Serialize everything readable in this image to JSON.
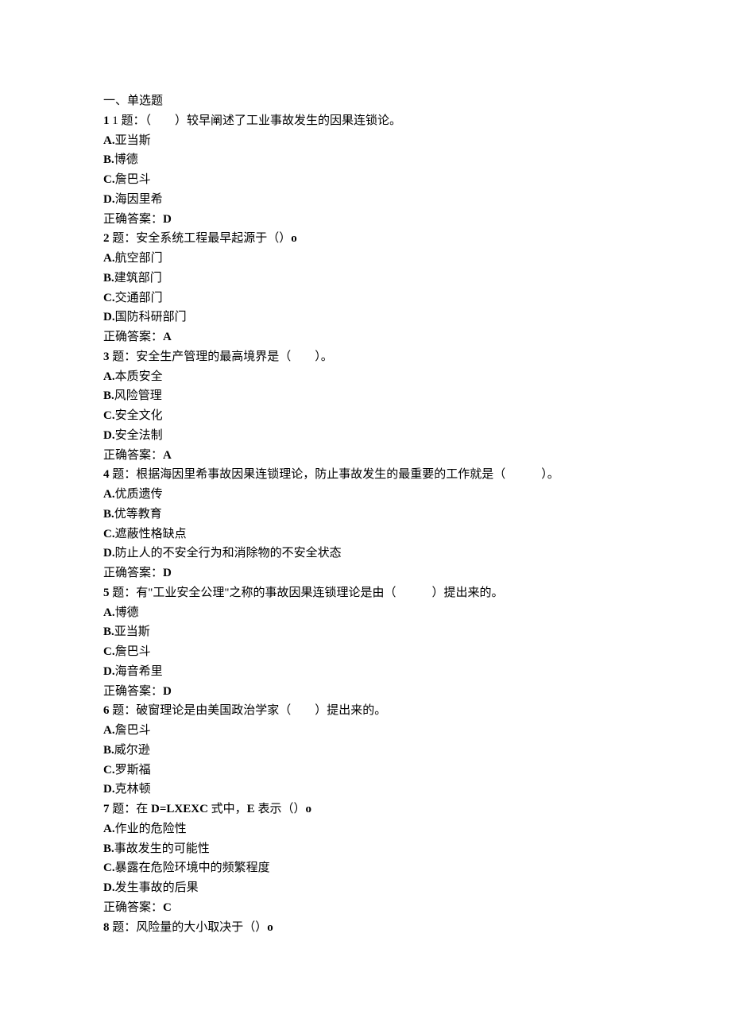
{
  "sectionHeader": "一、单选题",
  "questions": [
    {
      "header": "1 题：（　　）较早阐述了工业事故发生的因果连锁论。",
      "options": [
        "A.亚当斯",
        "B.博德",
        "C.詹巴斗",
        "D.海因里希"
      ],
      "answer": "正确答案：D"
    },
    {
      "header": "2 题：安全系统工程最早起源于（）o",
      "options": [
        "A.航空部门",
        "B.建筑部门",
        "C.交通部门",
        "D.国防科研部门"
      ],
      "answer": "正确答案：A"
    },
    {
      "header": "3 题：安全生产管理的最高境界是（　　）。",
      "options": [
        "A.本质安全",
        "B.风险管理",
        "C.安全文化",
        "D.安全法制"
      ],
      "answer": "正确答案：A"
    },
    {
      "header": "4 题：根据海因里希事故因果连锁理论，防止事故发生的最重要的工作就是（　　　）。",
      "options": [
        "A.优质遗传",
        "B.优等教育",
        "C.遮蔽性格缺点",
        "D.防止人的不安全行为和消除物的不安全状态"
      ],
      "answer": "正确答案：D"
    },
    {
      "header": "5 题：有\"工业安全公理\"之称的事故因果连锁理论是由（　　　）提出来的。",
      "options": [
        "A.博德",
        "B.亚当斯",
        "C.詹巴斗",
        "D.海音希里"
      ],
      "answer": "正确答案：D"
    },
    {
      "header": "6 题：破窗理论是由美国政治学家（　　）提出来的。",
      "options": [
        "A.詹巴斗",
        "B.威尔逊",
        "C.罗斯福",
        "D.克林顿"
      ],
      "answer": null
    },
    {
      "header": "7 题：在 D=LXEXC 式中，E 表示（）o",
      "options": [
        "A.作业的危险性",
        "B.事故发生的可能性",
        "C.暴露在危险环境中的频繁程度",
        "D.发生事故的后果"
      ],
      "answer": "正确答案：C"
    },
    {
      "header": "8 题：风险量的大小取决于（）o",
      "options": [],
      "answer": null
    }
  ]
}
